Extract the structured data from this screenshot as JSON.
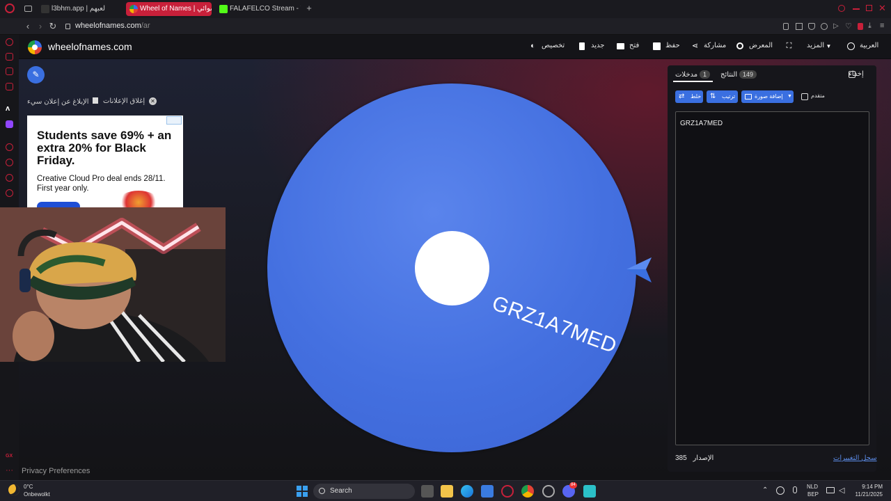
{
  "browser": {
    "tabs": [
      {
        "label": "l3bhm.app | لعبهم",
        "active": false
      },
      {
        "label": "Wheel of Names | عشوائي",
        "active": true
      },
      {
        "label": "FALAFELCO Stream - Wat",
        "active": false
      }
    ],
    "new_tab_label": "+",
    "url_host": "wheelofnames.com",
    "url_path": "/ar"
  },
  "site": {
    "name": "wheelofnames.com",
    "menu": {
      "customize": "تخصيص",
      "new": "جديد",
      "open": "فتح",
      "save": "حفظ",
      "share": "مشاركة",
      "gallery": "المعرض",
      "more": "المزيد",
      "language": "العربية"
    }
  },
  "ads": {
    "report": "الإبلاغ عن إعلان سيء",
    "close": "إغلاق الإعلانات",
    "banner_headline": "Students save 69% + an extra 20% for Black Friday.",
    "banner_sub": "Creative Cloud Pro deal ends 28/11. First year only."
  },
  "wheel": {
    "entries": [
      "GRZ1A7MED"
    ],
    "color": "#4470e0"
  },
  "panel": {
    "hide_label": "إخفاء",
    "results_tab": "النتائج",
    "results_count": "149",
    "entries_tab": "مدخلات",
    "entries_count": "1",
    "advanced_label": "متقدم",
    "add_image_label": "إضافة صورة",
    "sort_label": "ترتيب",
    "shuffle_label": "خلط",
    "entries_text": "GRZ1A7MED",
    "version_label": "الإصدار",
    "version_number": "385",
    "changelog_link": "سجل التغييرات"
  },
  "footer": {
    "privacy": "Privacy Preferences"
  },
  "taskbar": {
    "weather_temp": "0°C",
    "weather_desc": "Onbewolkt",
    "search_placeholder": "Search",
    "lang_top": "NLD",
    "lang_bottom": "BEP",
    "time": "9:14 PM",
    "date": "11/21/2025",
    "discord_badge": "84"
  },
  "colors": {
    "accent": "#3a6fe0",
    "opera_red": "#c8203a"
  }
}
